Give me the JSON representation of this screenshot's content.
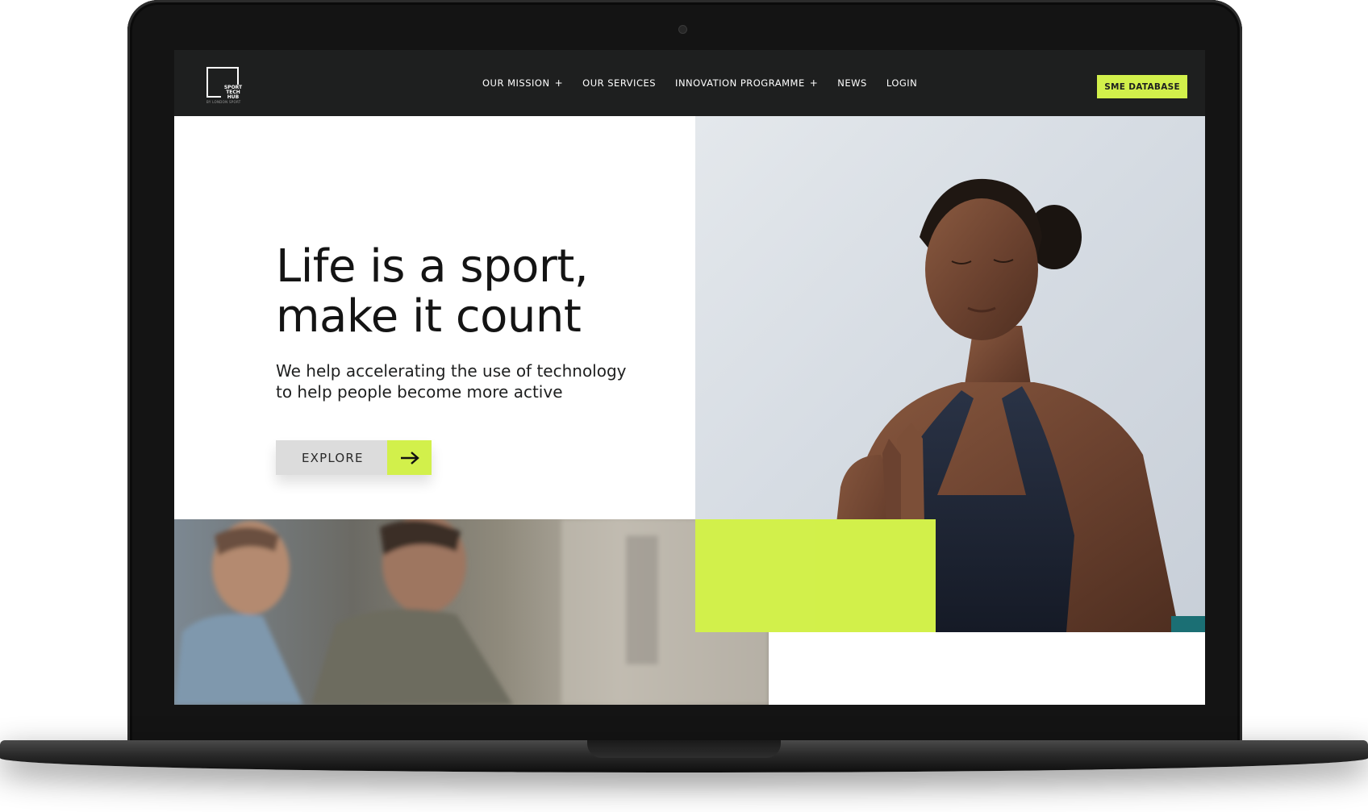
{
  "header": {
    "logo_text": "SPORT TECH HUB",
    "logo_sub": "BY LONDON SPORT",
    "nav": [
      {
        "label": "OUR MISSION",
        "suffix": "+"
      },
      {
        "label": "OUR SERVICES",
        "suffix": ""
      },
      {
        "label": "INNOVATION PROGRAMME",
        "suffix": "+"
      },
      {
        "label": "NEWS",
        "suffix": ""
      },
      {
        "label": "LOGIN",
        "suffix": ""
      }
    ],
    "cta_label": "SME DATABASE"
  },
  "hero": {
    "title_line1": "Life is a sport,",
    "title_line2": "make it count",
    "subtitle_line1": "We help accelerating the use of technology",
    "subtitle_line2": "to help people become more active",
    "button_label": "EXPLORE"
  },
  "colors": {
    "accent": "#d2f04b",
    "header_bg": "#1e1f1f",
    "button_gray": "#dcdcdc",
    "text_dark": "#141414"
  },
  "icons": {
    "explore_arrow": "arrow-right-icon",
    "nav_expand": "plus-icon"
  }
}
